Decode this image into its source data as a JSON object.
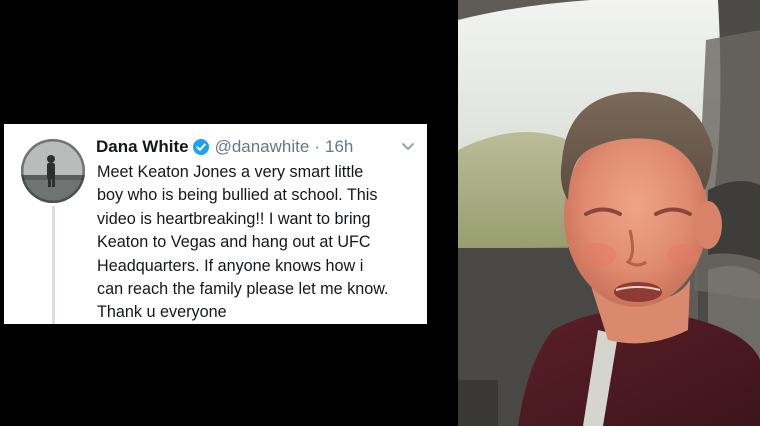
{
  "tweet": {
    "display_name": "Dana White",
    "handle": "@danawhite",
    "separator": "·",
    "time": "16h",
    "body_lines": [
      "Meet Keaton Jones a very smart little",
      "boy who is being bullied at school. This",
      "video is heartbreaking!! I want to bring",
      "Keaton to Vegas and hang out at UFC",
      "Headquarters. If anyone knows how i",
      "can reach the family please let me know.",
      "Thank u everyone"
    ],
    "icons": {
      "verified": "verified-badge-icon",
      "menu": "chevron-down-icon"
    },
    "colors": {
      "verified": "#1da1f2",
      "name": "#14171a",
      "meta": "#657786"
    }
  },
  "video_frame": {
    "subject": "boy-in-car-photo"
  }
}
